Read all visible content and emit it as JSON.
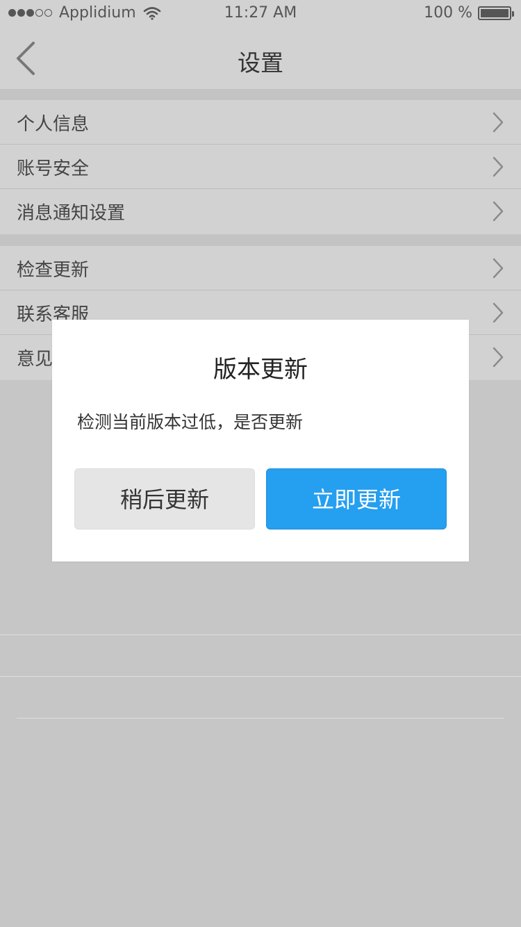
{
  "status_bar": {
    "carrier": "Applidium",
    "time": "11:27 AM",
    "battery": "100 %",
    "signal_dots": [
      true,
      true,
      true,
      false,
      false
    ],
    "icons": [
      "wifi-icon",
      "battery-icon"
    ]
  },
  "nav": {
    "title": "设置",
    "back_icon": "chevron-left-icon"
  },
  "settings": {
    "group1": [
      {
        "label": "个人信息"
      },
      {
        "label": "账号安全"
      },
      {
        "label": "消息通知设置"
      }
    ],
    "group2": [
      {
        "label": "检查更新"
      },
      {
        "label": "联系客服"
      },
      {
        "label": "意见反馈"
      }
    ]
  },
  "dialog": {
    "title": "版本更新",
    "message": "检测当前版本过低，是否更新",
    "later_label": "稍后更新",
    "now_label": "立即更新"
  },
  "colors": {
    "primary_button": "#259ff0",
    "overlay": "#c6c6c6"
  }
}
